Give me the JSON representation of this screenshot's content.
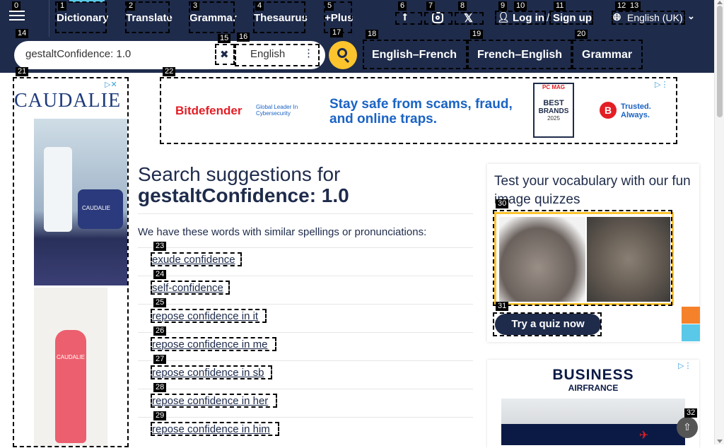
{
  "nav": {
    "items": [
      "Dictionary",
      "Translate",
      "Grammar",
      "Thesaurus",
      "+Plus"
    ],
    "login": "Log in",
    "slash": "/",
    "signup": "Sign up",
    "language": "English (UK)"
  },
  "search": {
    "value": "gestaltConfidence: 1.0",
    "dict_select": "English",
    "tabs": [
      "English–French",
      "French–English",
      "Grammar"
    ]
  },
  "ads": {
    "left_brand": "CAUDALIE",
    "left_bottle_brand": "CAUDALIE",
    "left_bottle_brand2": "CAUDALIE",
    "top_brand": "Bitdefender",
    "top_tagline": "Global Leader In Cybersecurity",
    "top_headline": "Stay safe from scams, fraud, and online traps.",
    "top_badge_title": "PC MAG",
    "top_badge_line1": "BEST",
    "top_badge_line2": "BRANDS",
    "top_badge_year": "2025",
    "top_trusted": "Trusted. Always.",
    "right_brand": "BUSINESS",
    "right_brand2": "AIRFRANCE"
  },
  "main": {
    "title_prefix": "Search suggestions for",
    "title_term": "gestaltConfidence: 1.0",
    "intro": "We have these words with similar spellings or pronunciations:",
    "suggestions": [
      "exude confidence",
      "self-confidence",
      "repose confidence in it",
      "repose confidence in me",
      "repose confidence in sb",
      "repose confidence in her",
      "repose confidence in him"
    ]
  },
  "quiz": {
    "title": "Test your vocabulary with our fun image quizzes",
    "button": "Try a quiz now"
  },
  "labels": [
    "0",
    "1",
    "2",
    "3",
    "4",
    "5",
    "6",
    "7",
    "8",
    "9",
    "10",
    "11",
    "12",
    "13",
    "14",
    "15",
    "16",
    "17",
    "18",
    "19",
    "20",
    "21",
    "22",
    "23",
    "24",
    "25",
    "26",
    "27",
    "28",
    "29",
    "30",
    "31",
    "32"
  ],
  "colors": {
    "navy": "#1e2b4b",
    "yellow": "#fec42d",
    "orange": "#f5822a",
    "cyan": "#5ac8e8"
  }
}
